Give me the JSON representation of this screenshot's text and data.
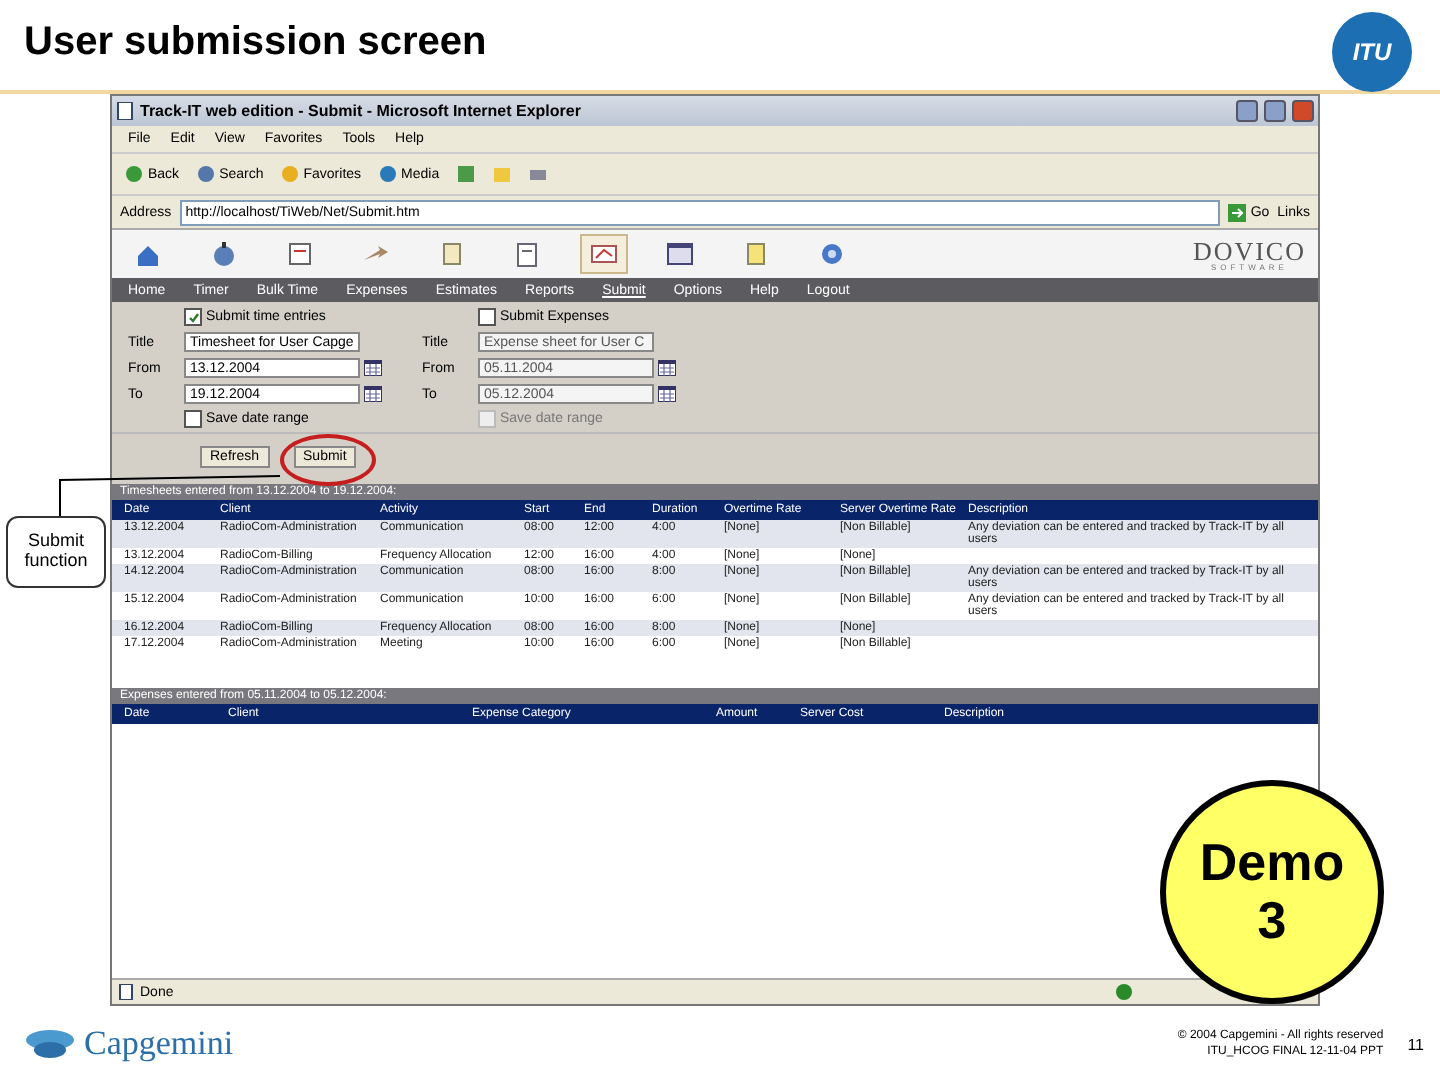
{
  "slide": {
    "title": "User submission screen",
    "itu_logo": "ITU",
    "callout": "Submit function",
    "demo_badge": {
      "line1": "Demo",
      "line2": "3"
    },
    "footer": {
      "logo": "Capgemini",
      "copyright": "© 2004 Capgemini - All rights reserved",
      "file": "ITU_HCOG FINAL 12-11-04 PPT",
      "page": "11"
    }
  },
  "browser": {
    "title": "Track-IT web edition - Submit - Microsoft Internet Explorer",
    "menu": [
      "File",
      "Edit",
      "View",
      "Favorites",
      "Tools",
      "Help"
    ],
    "toolbar": [
      "Back",
      "Search",
      "Favorites",
      "Media"
    ],
    "address_label": "Address",
    "url": "http://localhost/TiWeb/Net/Submit.htm",
    "go": "Go",
    "links": "Links",
    "status": "Done"
  },
  "app": {
    "logo": {
      "name": "DOVICO",
      "tagline": "SOFTWARE"
    },
    "nav": [
      {
        "label": "Home",
        "selected": false
      },
      {
        "label": "Timer",
        "selected": false
      },
      {
        "label": "Bulk Time",
        "selected": false
      },
      {
        "label": "Expenses",
        "selected": false
      },
      {
        "label": "Estimates",
        "selected": false
      },
      {
        "label": "Reports",
        "selected": false
      },
      {
        "label": "Submit",
        "selected": true
      },
      {
        "label": "Options",
        "selected": false
      },
      {
        "label": "Help",
        "selected": false
      },
      {
        "label": "Logout",
        "selected": false
      }
    ]
  },
  "timesheet_form": {
    "submit": {
      "label": "Submit time entries",
      "checked": true
    },
    "fields": [
      {
        "label": "Title",
        "value": "Timesheet for User Capge",
        "disabled": false
      },
      {
        "label": "From",
        "value": "13.12.2004",
        "disabled": false
      },
      {
        "label": "To",
        "value": "19.12.2004",
        "disabled": false
      }
    ],
    "save_range": {
      "label": "Save date range",
      "checked": false,
      "disabled": false
    }
  },
  "expense_form": {
    "submit": {
      "label": "Submit Expenses",
      "checked": false
    },
    "fields": [
      {
        "label": "Title",
        "value": "Expense sheet for User C",
        "disabled": true
      },
      {
        "label": "From",
        "value": "05.11.2004",
        "disabled": true
      },
      {
        "label": "To",
        "value": "05.12.2004",
        "disabled": true
      }
    ],
    "save_range": {
      "label": "Save date range",
      "checked": false,
      "disabled": true
    }
  },
  "buttons": [
    "Refresh",
    "Submit"
  ],
  "timesheets": {
    "heading": "Timesheets entered from 13.12.2004 to 19.12.2004:",
    "columns": [
      "Date",
      "Client",
      "Activity",
      "Start",
      "End",
      "Duration",
      "Overtime Rate",
      "Server Overtime Rate",
      "Description"
    ],
    "rows": [
      {
        "cells": [
          "13.12.2004",
          "RadioCom-Administration",
          "Communication",
          "08:00",
          "12:00",
          "4:00",
          "[None]",
          "[Non Billable]",
          "Any deviation can be entered and tracked by Track-IT by all users"
        ]
      },
      {
        "cells": [
          "13.12.2004",
          "RadioCom-Billing",
          "Frequency Allocation",
          "12:00",
          "16:00",
          "4:00",
          "[None]",
          "[None]",
          ""
        ]
      },
      {
        "cells": [
          "14.12.2004",
          "RadioCom-Administration",
          "Communication",
          "08:00",
          "16:00",
          "8:00",
          "[None]",
          "[Non Billable]",
          "Any deviation can be entered and tracked by Track-IT by all users"
        ]
      },
      {
        "cells": [
          "15.12.2004",
          "RadioCom-Administration",
          "Communication",
          "10:00",
          "16:00",
          "6:00",
          "[None]",
          "[Non Billable]",
          "Any deviation can be entered and tracked by Track-IT by all users"
        ]
      },
      {
        "cells": [
          "16.12.2004",
          "RadioCom-Billing",
          "Frequency Allocation",
          "08:00",
          "16:00",
          "8:00",
          "[None]",
          "[None]",
          ""
        ]
      },
      {
        "cells": [
          "17.12.2004",
          "RadioCom-Administration",
          "Meeting",
          "10:00",
          "16:00",
          "6:00",
          "[None]",
          "[Non Billable]",
          ""
        ]
      }
    ]
  },
  "expenses": {
    "heading": "Expenses entered from 05.11.2004 to 05.12.2004:",
    "columns": [
      "Date",
      "Client",
      "Expense Category",
      "Amount",
      "Server Cost",
      "Description"
    ]
  }
}
